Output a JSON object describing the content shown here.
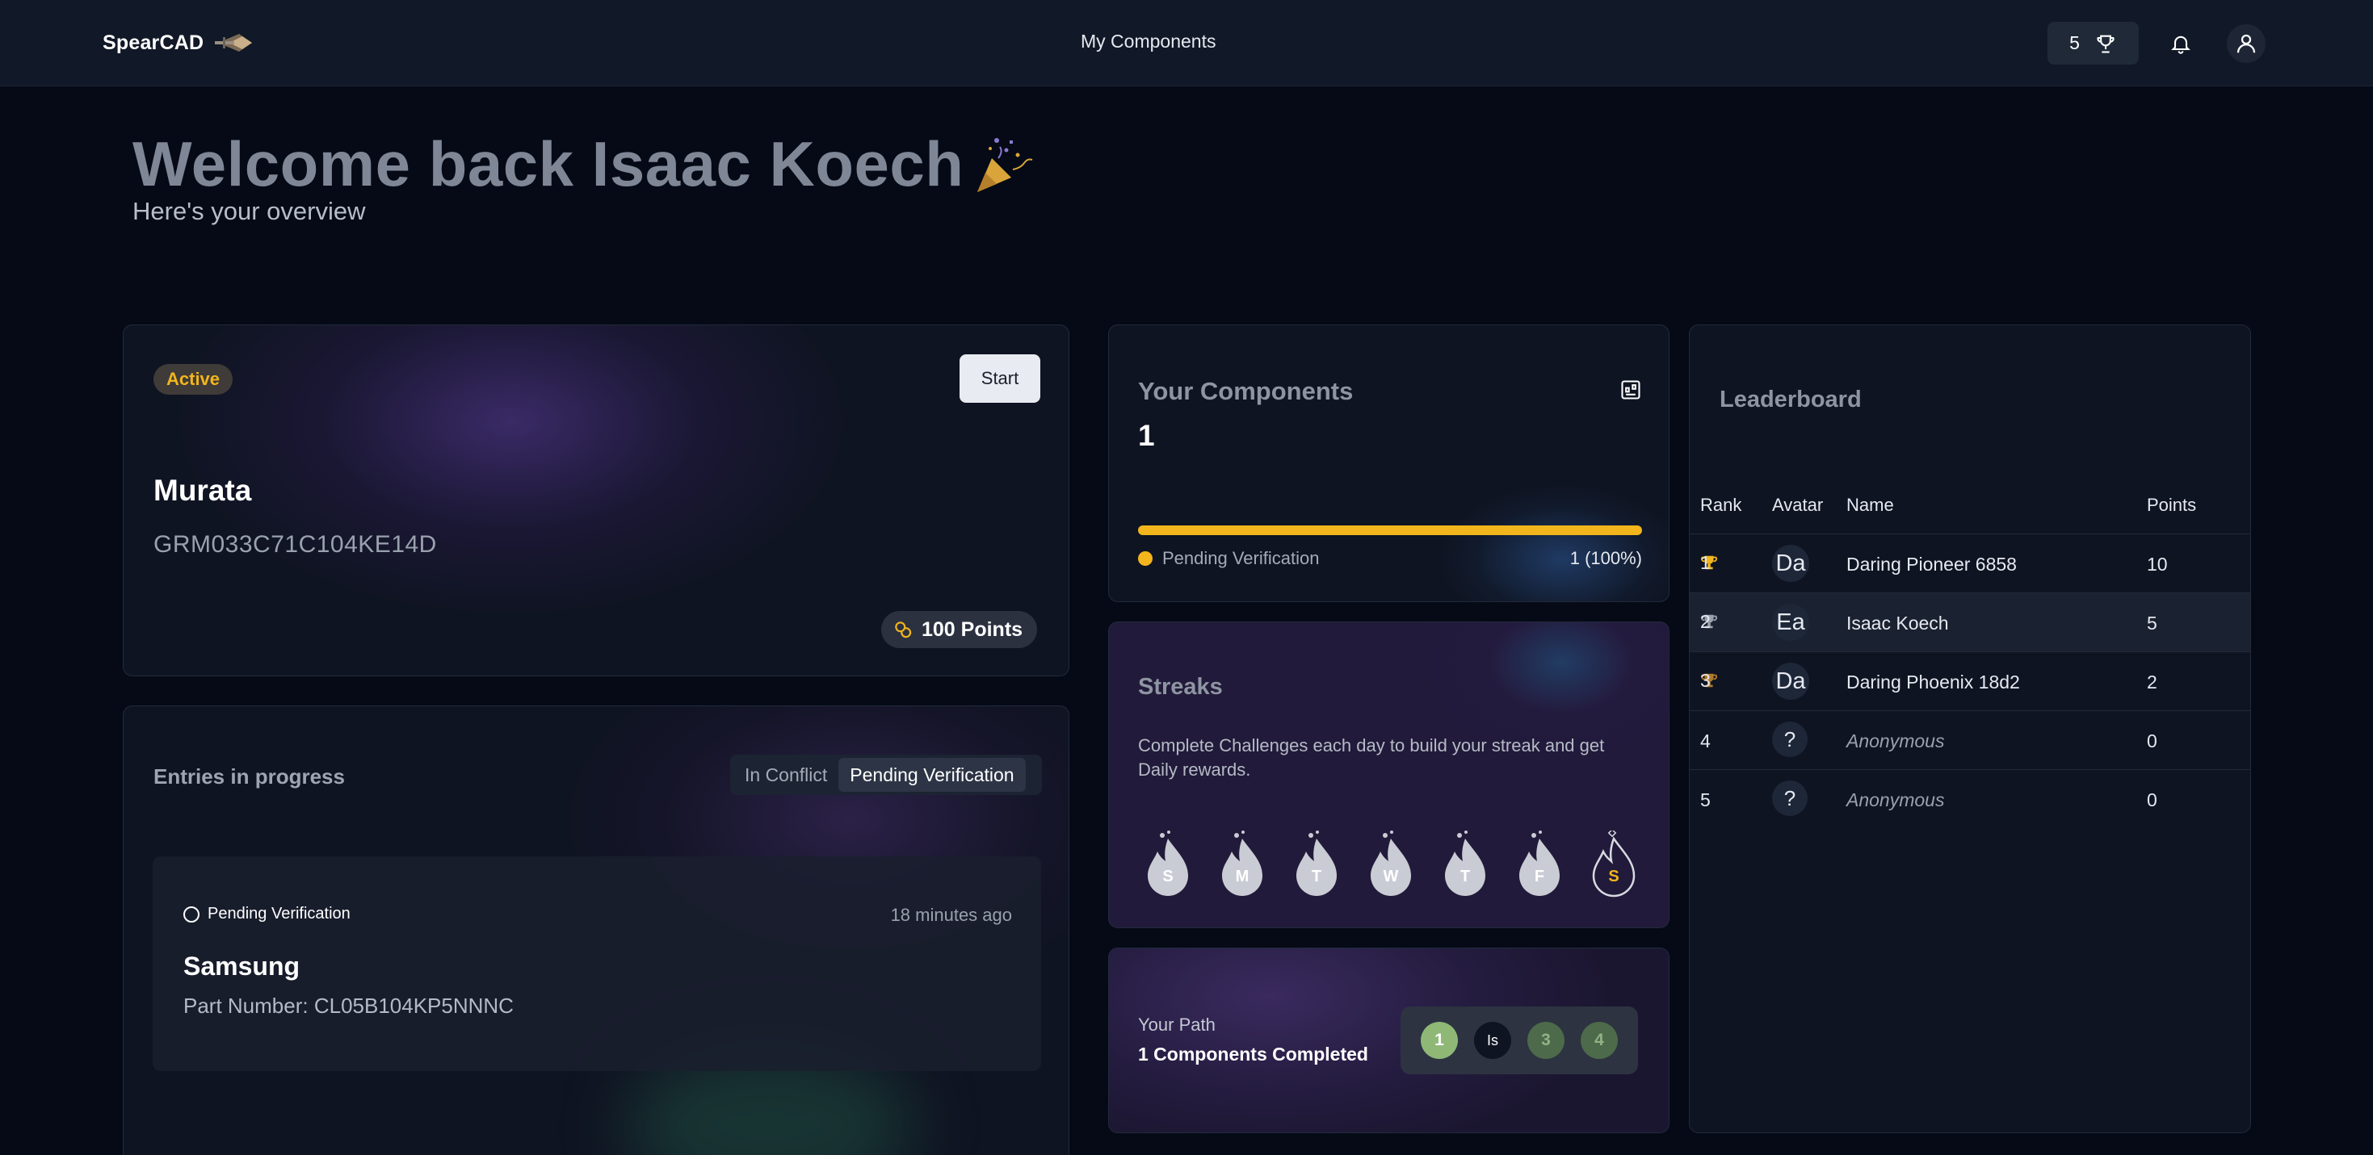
{
  "nav": {
    "brand": "SpearCAD",
    "center_link": "My Components",
    "points": "5",
    "icons": {
      "trophy": "trophy-icon",
      "bell": "bell-icon",
      "user": "user-icon"
    }
  },
  "hero": {
    "title": "Welcome back Isaac Koech",
    "subtitle": "Here's your overview"
  },
  "component_card": {
    "status": "Active",
    "start_label": "Start",
    "manufacturer": "Murata",
    "part_number": "GRM033C71C104KE14D",
    "points_label": "100 Points"
  },
  "entries": {
    "title": "Entries in progress",
    "tabs": [
      "In Conflict",
      "Pending Verification"
    ],
    "selected_tab": "Pending Verification",
    "items": [
      {
        "status": "Pending Verification",
        "time": "18 minutes ago",
        "manufacturer": "Samsung",
        "part": "Part Number: CL05B104KP5NNNC"
      }
    ]
  },
  "your_components": {
    "title": "Your Components",
    "count": "1",
    "progress_fraction": 1.0,
    "legend_label": "Pending Verification",
    "legend_value": "1 (100%)",
    "accent": "#f2b51c"
  },
  "streaks": {
    "title": "Streaks",
    "description": "Complete Challenges each day to build your streak and get Daily rewards.",
    "days": [
      "S",
      "M",
      "T",
      "W",
      "T",
      "F",
      "S"
    ]
  },
  "path": {
    "label": "Your Path",
    "subtitle": "1 Components Completed",
    "steps": [
      "1",
      "Is",
      "3",
      "4"
    ]
  },
  "leaderboard": {
    "title": "Leaderboard",
    "headers": {
      "rank": "Rank",
      "avatar": "Avatar",
      "name": "Name",
      "points": "Points"
    },
    "rows": [
      {
        "rank": "1",
        "avatar": "Da",
        "name": "Daring Pioneer 6858",
        "points": "10"
      },
      {
        "rank": "2",
        "avatar": "Ea",
        "name": "Isaac Koech",
        "points": "5"
      },
      {
        "rank": "3",
        "avatar": "Da",
        "name": "Daring Phoenix 18d2",
        "points": "2"
      },
      {
        "rank": "4",
        "avatar": "?",
        "name": "Anonymous",
        "points": "0"
      },
      {
        "rank": "5",
        "avatar": "?",
        "name": "Anonymous",
        "points": "0"
      }
    ],
    "trophy_colors": [
      "#f2b51c",
      "#9aa1ae",
      "#b07a2a"
    ]
  }
}
